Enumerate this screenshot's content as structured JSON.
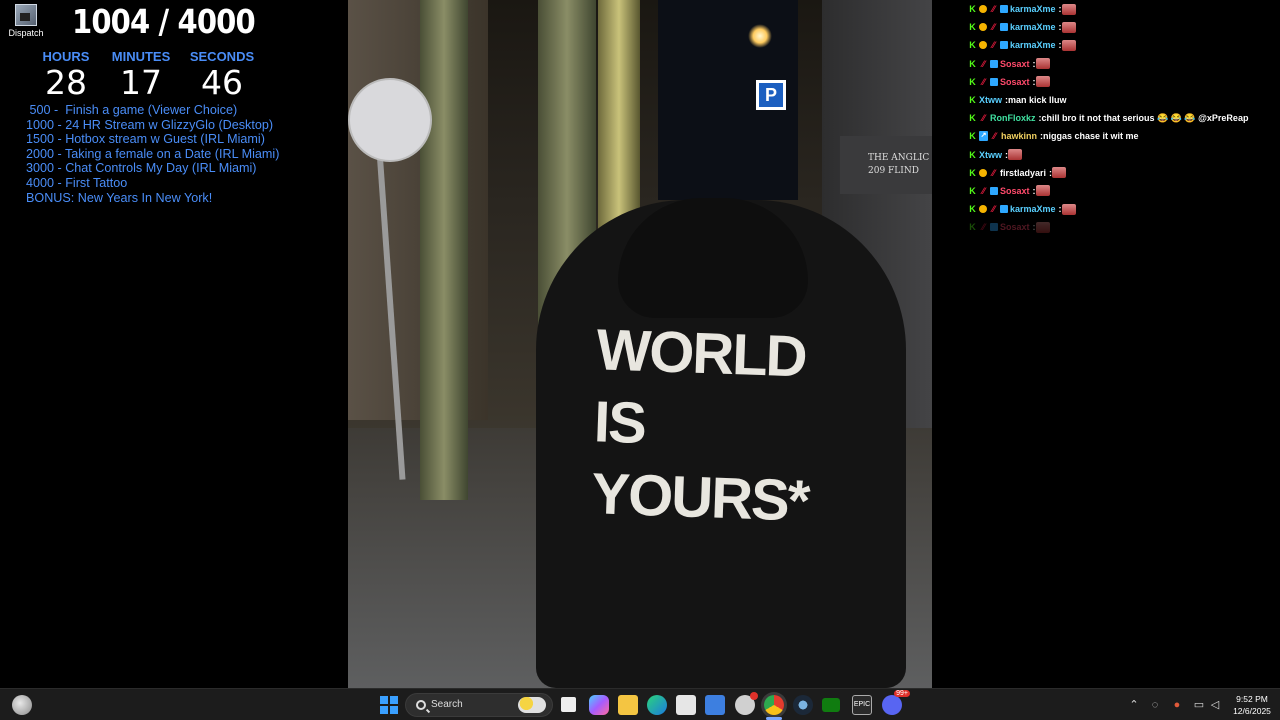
{
  "desktop_icon": {
    "label": "Dispatch"
  },
  "goal": {
    "text": "1004 / 4000"
  },
  "timer": {
    "hours_label": "HOURS",
    "hours": "28",
    "minutes_label": "MINUTES",
    "minutes": "17",
    "seconds_label": "SECONDS",
    "seconds": "46"
  },
  "milestones": [
    " 500 -  Finish a game (Viewer Choice)",
    "1000 - 24 HR Stream w GlizzyGlo (Desktop)",
    "1500 - Hotbox stream w Guest (IRL Miami)",
    "2000 - Taking a female on a Date (IRL Miami)",
    "3000 - Chat Controls My Day (IRL Miami)",
    "4000 - First Tattoo",
    "BONUS: New Years In New York!"
  ],
  "video": {
    "parking_sign": "P",
    "plaque_line1": "THE ANGLIC",
    "plaque_line2": "209 FLIND",
    "hoodie_line1": "WORLD",
    "hoodie_line2": "IS",
    "hoodie_line3": "YOURS*"
  },
  "chat": [
    {
      "user": "karmaXme",
      "color": "#5ad0ff",
      "message": ""
    },
    {
      "user": "karmaXme",
      "color": "#5ad0ff",
      "message": ""
    },
    {
      "user": "karmaXme",
      "color": "#5ad0ff",
      "message": ""
    },
    {
      "user": "Sosaxt",
      "color": "#ff4a6b",
      "message": ""
    },
    {
      "user": "Sosaxt",
      "color": "#ff4a6b",
      "message": ""
    },
    {
      "user": "Xtww",
      "color": "#5ad0ff",
      "message": "man kick lluw"
    },
    {
      "user": "RonFloxkz",
      "color": "#40e0a0",
      "message": "chill bro it not that serious 😂 😂 😂 @xPreReap"
    },
    {
      "user": "hawkinn",
      "color": "#f0d060",
      "message": "niggas chase it wit me"
    },
    {
      "user": "Xtww",
      "color": "#5ad0ff",
      "message": ""
    },
    {
      "user": "firstladyari",
      "color": "#ffffff",
      "message": ""
    },
    {
      "user": "Sosaxt",
      "color": "#ff4a6b",
      "message": ""
    },
    {
      "user": "karmaXme",
      "color": "#5ad0ff",
      "message": ""
    },
    {
      "user": "Sosaxt",
      "color": "#ff4a6b",
      "message": ""
    }
  ],
  "taskbar": {
    "search_placeholder": "Search",
    "epic_label": "EPIC",
    "time": "9:52 PM",
    "date": "12/6/2025"
  }
}
